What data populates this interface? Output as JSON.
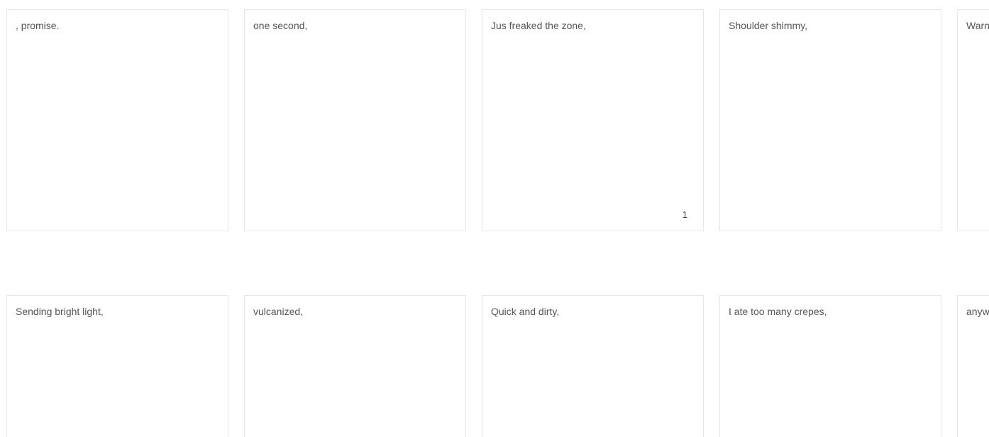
{
  "rows": [
    {
      "cards": [
        {
          "text": ", promise.",
          "count": ""
        },
        {
          "text": "one second,",
          "count": ""
        },
        {
          "text": "Jus freaked the zone,",
          "count": "1"
        },
        {
          "text": "Shoulder shimmy,",
          "count": ""
        },
        {
          "text": "Warn",
          "count": ""
        }
      ]
    },
    {
      "cards": [
        {
          "text": "Sending bright light,",
          "count": ""
        },
        {
          "text": "vulcanized,",
          "count": ""
        },
        {
          "text": "Quick and dirty,",
          "count": ""
        },
        {
          "text": "I ate too many crepes,",
          "count": ""
        },
        {
          "text": "anyw",
          "count": ""
        }
      ]
    }
  ]
}
